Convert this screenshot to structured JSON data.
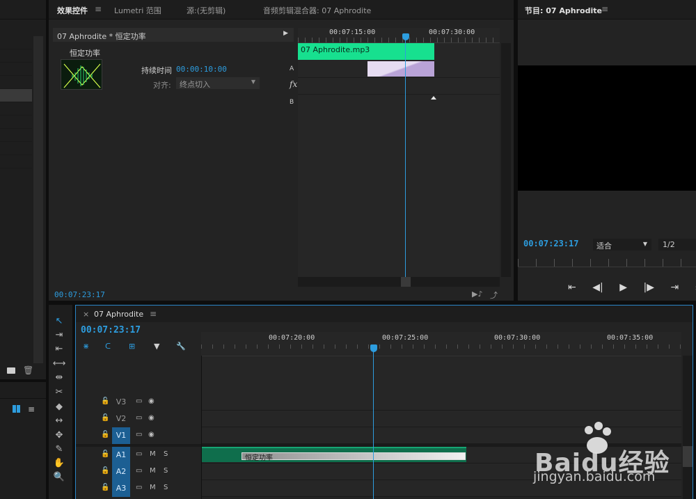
{
  "effects": {
    "tabs": [
      {
        "label": "效果控件",
        "active": true
      },
      {
        "label": "Lumetri 范围"
      },
      {
        "label": "源:(无剪辑)"
      },
      {
        "label": "音频剪辑混合器: 07 Aphrodite"
      }
    ],
    "header": "07 Aphrodite * 恒定功率",
    "ruler": [
      "00:07:15:00",
      "00:07:30:00"
    ],
    "effect_name": "恒定功率",
    "duration_label": "持续时间",
    "duration_value": "00:00:10:00",
    "align_label": "对齐:",
    "align_value": "终点切入",
    "clip_name": "07 Aphrodite.mp3",
    "lane_a": "A",
    "lane_fx": "fx",
    "lane_b": "B",
    "timecode": "00:07:23:17",
    "colors": {
      "clip": "#17e08f",
      "transition": "#d4c4e6",
      "playhead": "#2d9ddf"
    }
  },
  "program": {
    "tab": "节目: 07 Aphrodite",
    "timecode": "00:07:23:17",
    "fit": "适合",
    "resolution": "1/2"
  },
  "timeline": {
    "tab": "07 Aphrodite",
    "timecode": "00:07:23:17",
    "ruler": [
      "00:07:20:00",
      "00:07:25:00",
      "00:07:30:00",
      "00:07:35:00"
    ],
    "video_tracks": [
      "V3",
      "V2",
      "V1"
    ],
    "audio_tracks": [
      "A1",
      "A2",
      "A3"
    ],
    "mute": "M",
    "solo": "S",
    "transition_label": "恒定功率",
    "colors": {
      "audio_clip": "#0f6e4c"
    }
  },
  "watermark": {
    "brand": "Baidu经验",
    "url": "jingyan.baidu.com"
  }
}
